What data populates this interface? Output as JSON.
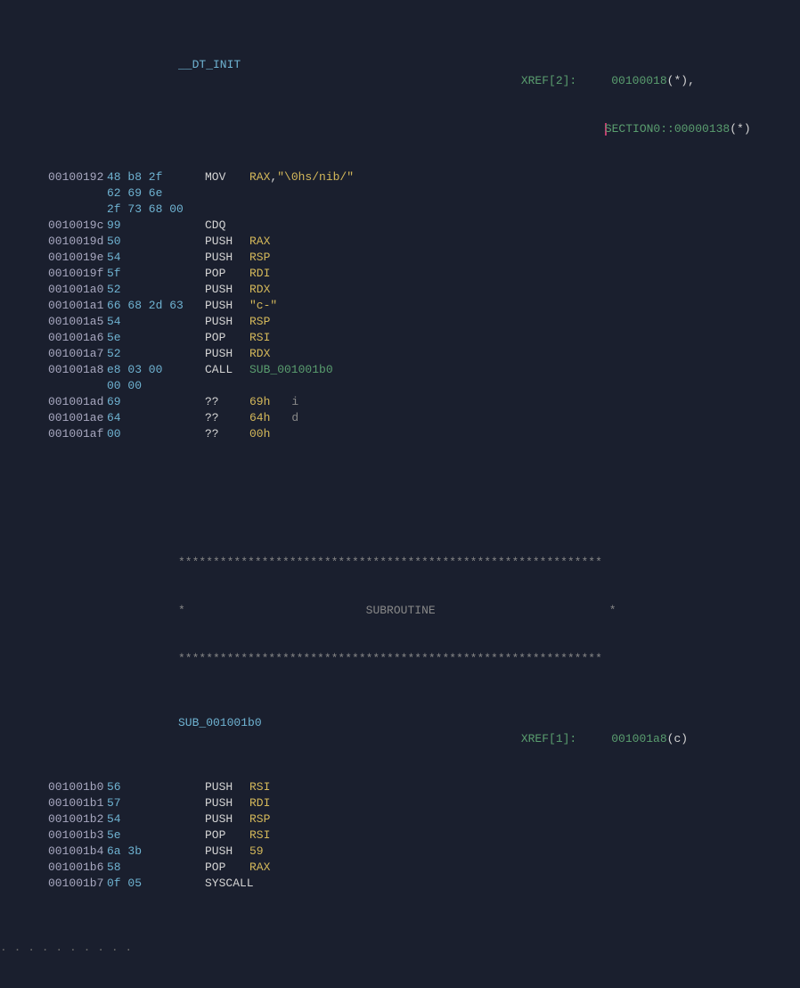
{
  "header": {
    "label": "__DT_INIT",
    "xref_label": "XREF[2]:",
    "xref1_addr": "00100018",
    "xref1_suffix": "(*)",
    "xref2_addr": "SECTION0::00000138",
    "xref2_suffix": "(*)"
  },
  "rows": [
    {
      "addr": "00100192",
      "bytes": "48 b8 2f",
      "mnem": "MOV",
      "op1": "RAX",
      "opsep": ",",
      "op2": "\"\\0hs/nib/\"",
      "op2_class": "str"
    },
    {
      "addr": "",
      "bytes": "62 69 6e",
      "mnem": "",
      "op1": "",
      "opsep": "",
      "op2": "",
      "op2_class": ""
    },
    {
      "addr": "",
      "bytes": "2f 73 68 00",
      "mnem": "",
      "op1": "",
      "opsep": "",
      "op2": "",
      "op2_class": ""
    },
    {
      "addr": "0010019c",
      "bytes": "99",
      "mnem": "CDQ",
      "op1": "",
      "opsep": "",
      "op2": "",
      "op2_class": ""
    },
    {
      "addr": "0010019d",
      "bytes": "50",
      "mnem": "PUSH",
      "op1": "RAX",
      "opsep": "",
      "op2": "",
      "op2_class": ""
    },
    {
      "addr": "0010019e",
      "bytes": "54",
      "mnem": "PUSH",
      "op1": "RSP",
      "opsep": "",
      "op2": "",
      "op2_class": ""
    },
    {
      "addr": "0010019f",
      "bytes": "5f",
      "mnem": "POP",
      "op1": "RDI",
      "opsep": "",
      "op2": "",
      "op2_class": ""
    },
    {
      "addr": "001001a0",
      "bytes": "52",
      "mnem": "PUSH",
      "op1": "RDX",
      "opsep": "",
      "op2": "",
      "op2_class": ""
    },
    {
      "addr": "001001a1",
      "bytes": "66 68 2d 63",
      "mnem": "PUSH",
      "op1": "",
      "opsep": "",
      "op2": "\"c-\"",
      "op2_class": "str"
    },
    {
      "addr": "001001a5",
      "bytes": "54",
      "mnem": "PUSH",
      "op1": "RSP",
      "opsep": "",
      "op2": "",
      "op2_class": ""
    },
    {
      "addr": "001001a6",
      "bytes": "5e",
      "mnem": "POP",
      "op1": "RSI",
      "opsep": "",
      "op2": "",
      "op2_class": ""
    },
    {
      "addr": "001001a7",
      "bytes": "52",
      "mnem": "PUSH",
      "op1": "RDX",
      "opsep": "",
      "op2": "",
      "op2_class": ""
    },
    {
      "addr": "001001a8",
      "bytes": "e8 03 00",
      "mnem": "CALL",
      "op1": "",
      "opsep": "",
      "op2": "SUB_001001b0",
      "op2_class": "sub"
    },
    {
      "addr": "",
      "bytes": "00 00",
      "mnem": "",
      "op1": "",
      "opsep": "",
      "op2": "",
      "op2_class": ""
    },
    {
      "addr": "001001ad",
      "bytes": "69",
      "mnem": "??",
      "op1": "",
      "opsep": "",
      "op2": "69h",
      "op2_class": "num",
      "char": "i"
    },
    {
      "addr": "001001ae",
      "bytes": "64",
      "mnem": "??",
      "op1": "",
      "opsep": "",
      "op2": "64h",
      "op2_class": "num",
      "char": "d"
    },
    {
      "addr": "001001af",
      "bytes": "00",
      "mnem": "??",
      "op1": "",
      "opsep": "",
      "op2": "00h",
      "op2_class": "num"
    }
  ],
  "sub_banner": {
    "stars": "*************************************************************",
    "title_prefix": "*",
    "title": "SUBROUTINE",
    "title_suffix": "*",
    "label": "SUB_001001b0",
    "xref_label": "XREF[1]:",
    "xref_addr": "001001a8",
    "xref_suffix": "(c)"
  },
  "rows2": [
    {
      "addr": "001001b0",
      "bytes": "56",
      "mnem": "PUSH",
      "op1": "RSI"
    },
    {
      "addr": "001001b1",
      "bytes": "57",
      "mnem": "PUSH",
      "op1": "RDI"
    },
    {
      "addr": "001001b2",
      "bytes": "54",
      "mnem": "PUSH",
      "op1": "RSP"
    },
    {
      "addr": "001001b3",
      "bytes": "5e",
      "mnem": "POP",
      "op1": "RSI"
    },
    {
      "addr": "001001b4",
      "bytes": "6a 3b",
      "mnem": "PUSH",
      "op1": "",
      "op2": "59",
      "op2_class": "num"
    },
    {
      "addr": "001001b6",
      "bytes": "58",
      "mnem": "POP",
      "op1": "RAX"
    },
    {
      "addr": "001001b7",
      "bytes": "0f 05",
      "mnem": "SYSCALL",
      "op1": ""
    }
  ],
  "footer_dots": ". . . . . . . . . ."
}
